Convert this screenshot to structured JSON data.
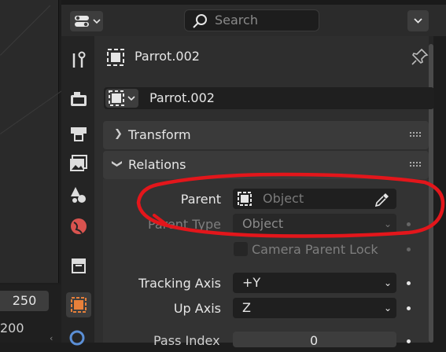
{
  "header": {
    "search_placeholder": "Search"
  },
  "timeline": {
    "frame_end": "250",
    "frame_other": "200"
  },
  "tabs": [
    {
      "name": "tool-tab",
      "icon": "wrench-screwdriver-icon"
    },
    {
      "name": "render-tab",
      "icon": "camera-back-icon"
    },
    {
      "name": "output-tab",
      "icon": "printer-icon"
    },
    {
      "name": "view-layer-tab",
      "icon": "images-icon"
    },
    {
      "name": "scene-tab",
      "icon": "scene-cone-icon"
    },
    {
      "name": "world-tab",
      "icon": "globe-icon"
    },
    {
      "name": "collection-tab",
      "icon": "box-icon"
    },
    {
      "name": "object-tab",
      "icon": "orange-square-icon",
      "active": true
    }
  ],
  "context": {
    "object_name": "Parrot.002"
  },
  "datablock": {
    "name": "Parrot.002"
  },
  "panels": {
    "transform": {
      "label": "Transform",
      "expanded": false
    },
    "relations": {
      "label": "Relations",
      "expanded": true
    }
  },
  "relations": {
    "parent_label": "Parent",
    "parent_placeholder": "Object",
    "parent_type_label": "Parent Type",
    "parent_type_value": "Object",
    "camera_parent_lock_label": "Camera Parent Lock",
    "tracking_axis_label": "Tracking Axis",
    "tracking_axis_value": "+Y",
    "up_axis_label": "Up Axis",
    "up_axis_value": "Z",
    "pass_index_label": "Pass Index",
    "pass_index_value": "0"
  },
  "colors": {
    "accent_orange": "#e8803a",
    "annotation_red": "#e3161b"
  }
}
